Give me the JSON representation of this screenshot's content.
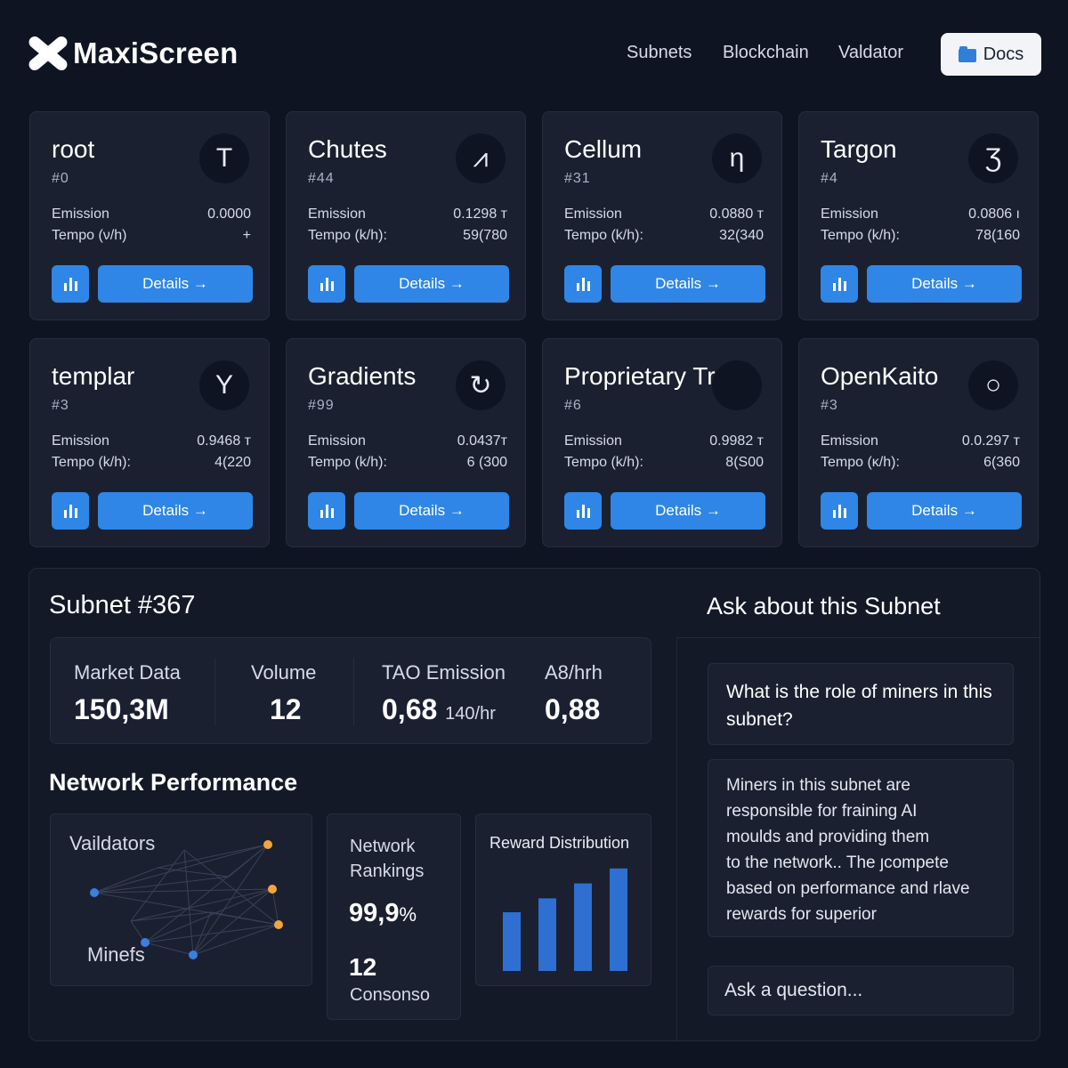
{
  "header": {
    "brand": "MaxiScreen",
    "nav": [
      "Subnets",
      "Blockchain",
      "Valdator"
    ],
    "docs_label": "Docs",
    "accent": "#2f86e6"
  },
  "cards": [
    {
      "name": "root",
      "number": "#0",
      "glyph": "T",
      "emission_label": "Emission",
      "emission_value": "0.0000",
      "tempo_label": "Tempo (ν/h)",
      "tempo_value": "+",
      "details": "Details →"
    },
    {
      "name": "Chutes",
      "number": "#44",
      "glyph": "⩘",
      "emission_label": "Emission",
      "emission_value": "0.1298 т",
      "tempo_label": "Tempo (k/h):",
      "tempo_value": "59(780",
      "details": "Details →"
    },
    {
      "name": "Cellum",
      "number": "#31",
      "glyph": "η",
      "emission_label": "Emission",
      "emission_value": "0.0880 т",
      "tempo_label": "Tempo (k/h):",
      "tempo_value": "32(340",
      "details": "Details →"
    },
    {
      "name": "Targon",
      "number": "#4",
      "glyph": "Ʒ",
      "emission_label": "Emission",
      "emission_value": "0.0806 ı",
      "tempo_label": "Tempo (k/h):",
      "tempo_value": "78(160",
      "details": "Details →"
    },
    {
      "name": "templar",
      "number": "#3",
      "glyph": "Y",
      "emission_label": "Emission",
      "emission_value": "0.9468 т",
      "tempo_label": "Tempo (k/h):",
      "tempo_value": "4(220",
      "details": "Details →"
    },
    {
      "name": "Gradients",
      "number": "#99",
      "glyph": "↻",
      "emission_label": "Emission",
      "emission_value": "0.0437т",
      "tempo_label": "Tempo (k/h):",
      "tempo_value": "6 (300",
      "details": "Details →"
    },
    {
      "name": "Proprietary Tradi..",
      "number": "#6",
      "glyph": "",
      "emission_label": "Emission",
      "emission_value": "0.9982 т",
      "tempo_label": "Tempo (k/h):",
      "tempo_value": "8(S00",
      "details": "Details →"
    },
    {
      "name": "OpenKaito",
      "number": "#3",
      "glyph": "○",
      "emission_label": "Emission",
      "emission_value": "0.0.297 т",
      "tempo_label": "Tempo (κ/h):",
      "tempo_value": "6(360",
      "details": "Details →"
    }
  ],
  "subnet": {
    "title": "Subnet #367",
    "market": [
      {
        "label": "Market Data",
        "value": "150,3M",
        "unit": ""
      },
      {
        "label": "Volume",
        "value": "12",
        "unit": ""
      },
      {
        "label": "TAO Emission",
        "value": "0,68",
        "unit": "140/hr"
      },
      {
        "label": "A8/hrh",
        "value": "0,88",
        "unit": ""
      }
    ],
    "network_title": "Network Performance",
    "graph": {
      "validators_label": "Vaildators",
      "miners_label": "Minefs",
      "validator_color": "#f5a33c",
      "miner_color": "#3b7fe0"
    },
    "rankings": {
      "label": "Network Rankings",
      "percent": "99,9",
      "percent_sign": "%",
      "count": "12",
      "sub": "Consonso"
    },
    "reward": {
      "label": "Reward Distribution",
      "bar_color": "#2f6fd1",
      "values": [
        0.55,
        0.68,
        0.82,
        0.96
      ]
    }
  },
  "chat": {
    "title": "Ask about this Subnet",
    "question": "What is the role of miners in this subnet?",
    "answer_lines": [
      "Miners in this subnet are",
      "responsible for fraining AI",
      "moulds and providing them",
      "to the network.. The ȷcompete",
      "based on performance and rlave",
      "rewards for superior"
    ],
    "input_placeholder": "Ask a question..."
  }
}
